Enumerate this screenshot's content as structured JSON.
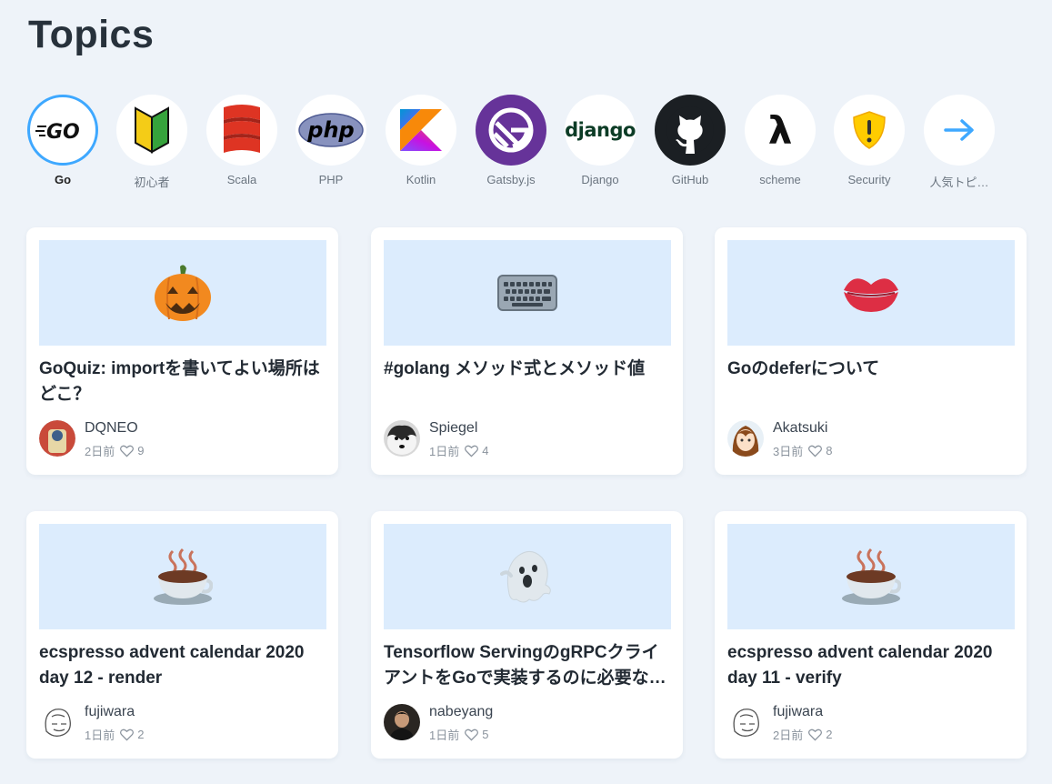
{
  "page": {
    "title": "Topics"
  },
  "topics": [
    {
      "label": "Go",
      "icon": "go-logo-icon",
      "active": true
    },
    {
      "label": "初心者",
      "icon": "beginner-mark-icon"
    },
    {
      "label": "Scala",
      "icon": "scala-logo-icon"
    },
    {
      "label": "PHP",
      "icon": "php-logo-icon",
      "logo_text": "php"
    },
    {
      "label": "Kotlin",
      "icon": "kotlin-logo-icon"
    },
    {
      "label": "Gatsby.js",
      "icon": "gatsby-logo-icon"
    },
    {
      "label": "Django",
      "icon": "django-logo-icon",
      "logo_text": "django"
    },
    {
      "label": "GitHub",
      "icon": "github-logo-icon"
    },
    {
      "label": "scheme",
      "icon": "lambda-icon",
      "logo_text": "λ"
    },
    {
      "label": "Security",
      "icon": "warning-shield-icon"
    },
    {
      "label": "人気トピ…",
      "icon": "arrow-right-icon"
    }
  ],
  "articles": [
    {
      "emoji": "🎃",
      "title": "GoQuiz: importを書いてよい場所はどこ？",
      "author": "DQNEO",
      "time": "2日前",
      "likes": "9",
      "avatar": "avatar-dqneo"
    },
    {
      "emoji": "⌨️",
      "title": "#golang メソッド式とメソッド値",
      "author": "Spiegel",
      "time": "1日前",
      "likes": "4",
      "avatar": "avatar-spiegel"
    },
    {
      "emoji": "💋",
      "title": "Goのdeferについて",
      "author": "Akatsuki",
      "time": "3日前",
      "likes": "8",
      "avatar": "avatar-akatsuki"
    },
    {
      "emoji": "☕",
      "title": "ecspresso advent calendar 2020 day 12 - render",
      "author": "fujiwara",
      "time": "1日前",
      "likes": "2",
      "avatar": "avatar-fujiwara"
    },
    {
      "emoji": "👻",
      "title": "Tensorflow ServingのgRPCクライアントをGoで実装するのに必要な…",
      "author": "nabeyang",
      "time": "1日前",
      "likes": "5",
      "avatar": "avatar-nabeyang"
    },
    {
      "emoji": "☕",
      "title": "ecspresso advent calendar 2020 day 11 - verify",
      "author": "fujiwara",
      "time": "2日前",
      "likes": "2",
      "avatar": "avatar-fujiwara"
    }
  ],
  "colors": {
    "accent": "#3ea8ff",
    "background": "#eef3f9",
    "thumb": "#dcecfd"
  }
}
